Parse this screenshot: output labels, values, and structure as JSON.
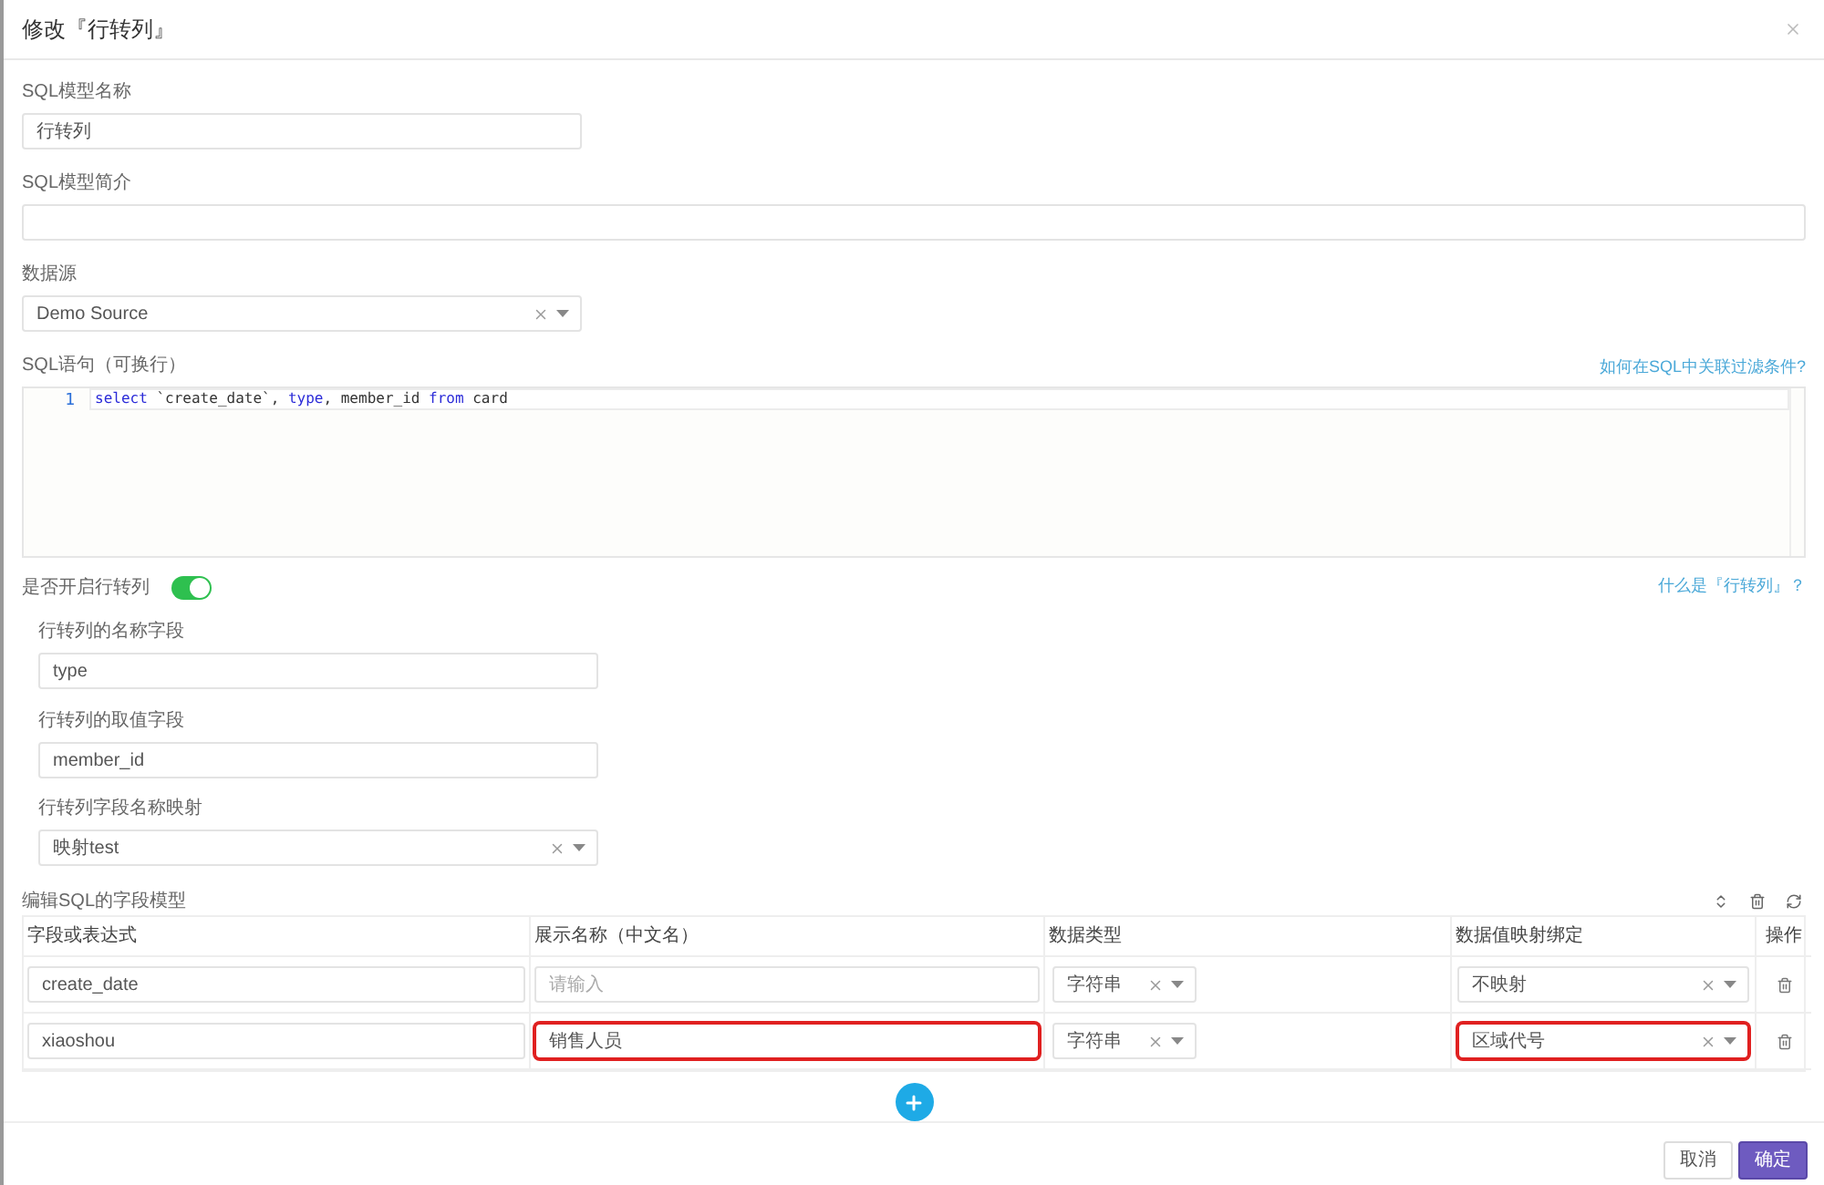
{
  "dialog": {
    "title": "修改『行转列』"
  },
  "model_name": {
    "label": "SQL模型名称",
    "value": "行转列"
  },
  "model_desc": {
    "label": "SQL模型简介"
  },
  "data_source": {
    "label": "数据源",
    "value": "Demo Source"
  },
  "sql": {
    "label": "SQL语句（可换行）",
    "help_link": "如何在SQL中关联过滤条件?",
    "lines": [
      {
        "number": "1",
        "tokens": [
          {
            "text": "select",
            "kind": "keyword"
          },
          {
            "text": " `create_date`, ",
            "kind": "plain"
          },
          {
            "text": "type",
            "kind": "keyword"
          },
          {
            "text": ", member_id ",
            "kind": "plain"
          },
          {
            "text": "from",
            "kind": "keyword"
          },
          {
            "text": " card",
            "kind": "plain"
          }
        ]
      }
    ]
  },
  "row_to_column": {
    "label": "是否开启行转列",
    "on": true,
    "help_link": "什么是『行转列』？",
    "name_field": {
      "label": "行转列的名称字段",
      "value": "type"
    },
    "value_field": {
      "label": "行转列的取值字段",
      "value": "member_id"
    },
    "name_mapping": {
      "label": "行转列字段名称映射",
      "value": "映射test"
    }
  },
  "field_model": {
    "title": "编辑SQL的字段模型",
    "columns": [
      "字段或表达式",
      "展示名称（中文名）",
      "数据类型",
      "数据值映射绑定",
      "操作"
    ],
    "rows": [
      {
        "field": "create_date",
        "display": {
          "placeholder": "请输入",
          "highlighted": false
        },
        "data_type": "字符串",
        "mapping": {
          "value": "不映射",
          "highlighted": false
        }
      },
      {
        "field": "xiaoshou",
        "display": {
          "value": "销售人员",
          "highlighted": true
        },
        "data_type": "字符串",
        "mapping": {
          "value": "区域代号",
          "highlighted": true
        }
      }
    ]
  },
  "footer": {
    "buttons": [
      {
        "label": "取消",
        "kind": "default"
      },
      {
        "label": "确定",
        "kind": "primary"
      }
    ]
  }
}
